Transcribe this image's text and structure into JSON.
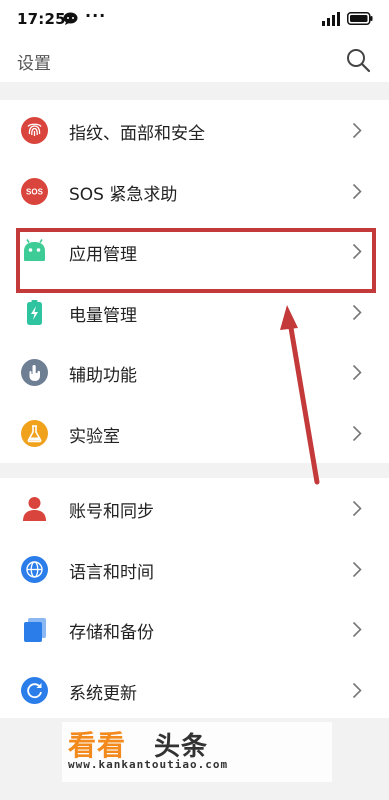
{
  "status_bar": {
    "time": "17:25",
    "dots": "···"
  },
  "header": {
    "title": "设置"
  },
  "groups": [
    {
      "items": [
        {
          "label": "指纹、面部和安全",
          "icon": "fingerprint-icon",
          "color": "#d9453d"
        },
        {
          "label": "SOS 紧急求助",
          "icon": "sos-icon",
          "color": "#d9453d"
        },
        {
          "label": "应用管理",
          "icon": "android-icon",
          "color": "#3dcc95"
        },
        {
          "label": "电量管理",
          "icon": "battery-icon",
          "color": "#2ec4a0"
        },
        {
          "label": "辅助功能",
          "icon": "hand-icon",
          "color": "#6e7f94"
        },
        {
          "label": "实验室",
          "icon": "flask-icon",
          "color": "#f0a21d"
        }
      ]
    },
    {
      "items": [
        {
          "label": "账号和同步",
          "icon": "person-icon",
          "color": "#d9453d"
        },
        {
          "label": "语言和时间",
          "icon": "globe-icon",
          "color": "#2b7de9"
        },
        {
          "label": "存储和备份",
          "icon": "storage-icon",
          "color": "#2b7de9"
        },
        {
          "label": "系统更新",
          "icon": "update-icon",
          "color": "#2b7de9"
        }
      ]
    }
  ],
  "watermark": {
    "brand": "看看",
    "brand2": "头条",
    "url": "www.kankantoutiao.com"
  },
  "annotation_color": "#c43a3a"
}
